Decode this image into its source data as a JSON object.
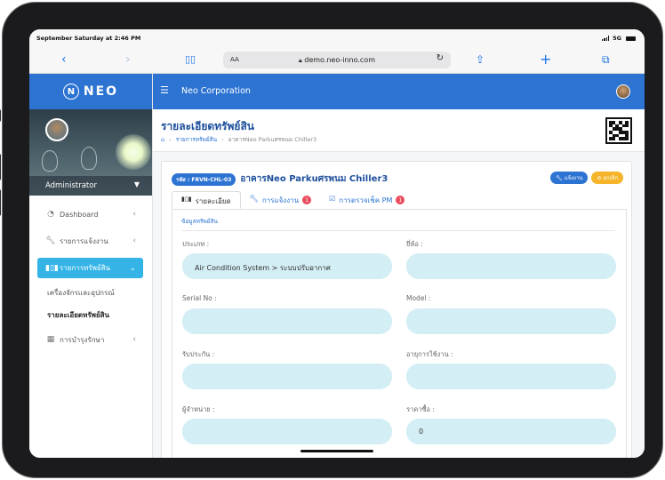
{
  "status": {
    "time": "September Saturday at 2:46 PM",
    "signal": "5G"
  },
  "browser": {
    "text_size": "AA",
    "url": "demo.neo-inno.com"
  },
  "brand": {
    "mark": "N",
    "name": "NEO"
  },
  "profile": {
    "name": "Administrator"
  },
  "menu": {
    "dashboard": "Dashboard",
    "reports": "รายการแจ้งงาน",
    "assets": "รายการทรัพย์สิน",
    "sub_machines": "เครื่องจักรและอุปกรณ์",
    "sub_detail": "รายละเอียดทรัพย์สิน",
    "maintenance": "การบำรุงรักษา"
  },
  "topnav": {
    "title": "Neo Corporation"
  },
  "page": {
    "title": "รายละเอียดทรัพย์สิน",
    "breadcrumb": [
      "รายการทรัพย์สิน",
      "อาคารNeo Parkuศรพนม Chiller3"
    ]
  },
  "asset": {
    "code_label": "รหัส : FRVN-CHL-03",
    "name": "อาคารNeo Parkuศรพนม Chiller3",
    "report_button": "แจ้งงาน",
    "cancel_button": "ยกเลิก"
  },
  "tabs": [
    {
      "label": "รายละเอียด",
      "badge": ""
    },
    {
      "label": "การแจ้งงาน",
      "badge": "1"
    },
    {
      "label": "การตรวจเช็ค PM",
      "badge": "1"
    }
  ],
  "section": {
    "title": "ข้อมูลทรัพย์สิน"
  },
  "fields": {
    "type": {
      "label": "ประเภท :",
      "value": "Air Condition System > ระบบปรับอากาศ"
    },
    "brand": {
      "label": "ยี่ห้อ :",
      "value": ""
    },
    "serial": {
      "label": "Serial No :",
      "value": ""
    },
    "model": {
      "label": "Model :",
      "value": ""
    },
    "warranty": {
      "label": "รับประกัน :",
      "value": ""
    },
    "lifespan": {
      "label": "อายุการใช้งาน :",
      "value": ""
    },
    "vendor": {
      "label": "ผู้จำหน่าย :",
      "value": ""
    },
    "price": {
      "label": "ราคาซื้อ :",
      "value": "0"
    }
  },
  "colors": {
    "primary": "#2c73d2",
    "active_menu": "#34b4e6",
    "field_bg": "#d3eef4",
    "badge": "#e84b5c",
    "warning": "#f5b429"
  }
}
